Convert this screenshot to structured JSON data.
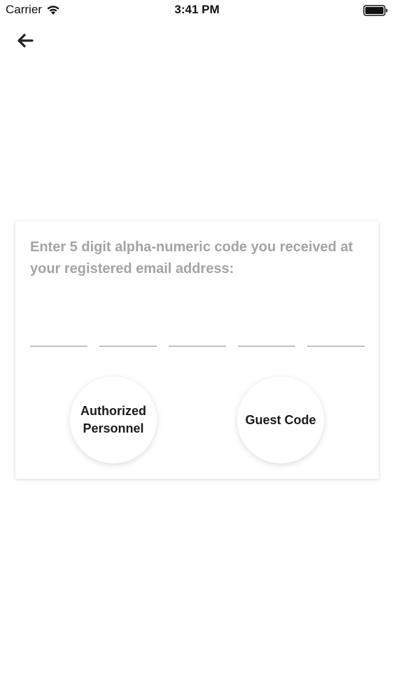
{
  "status_bar": {
    "carrier": "Carrier",
    "time": "3:41 PM",
    "wifi_icon": "wifi-icon",
    "battery_icon": "battery-full-icon"
  },
  "nav": {
    "back_icon": "arrow-left-icon"
  },
  "card": {
    "instructions": "Enter 5 digit alpha-numeric code you received at your registered email address:",
    "code_fields": [
      "",
      "",
      "",
      "",
      ""
    ],
    "authorized_label_line1": "Authorized",
    "authorized_label_line2": "Personnel",
    "guest_label": "Guest Code"
  },
  "colors": {
    "instruction_text": "#a4a4a4",
    "underline": "#8c8c8c",
    "background": "#ffffff"
  }
}
